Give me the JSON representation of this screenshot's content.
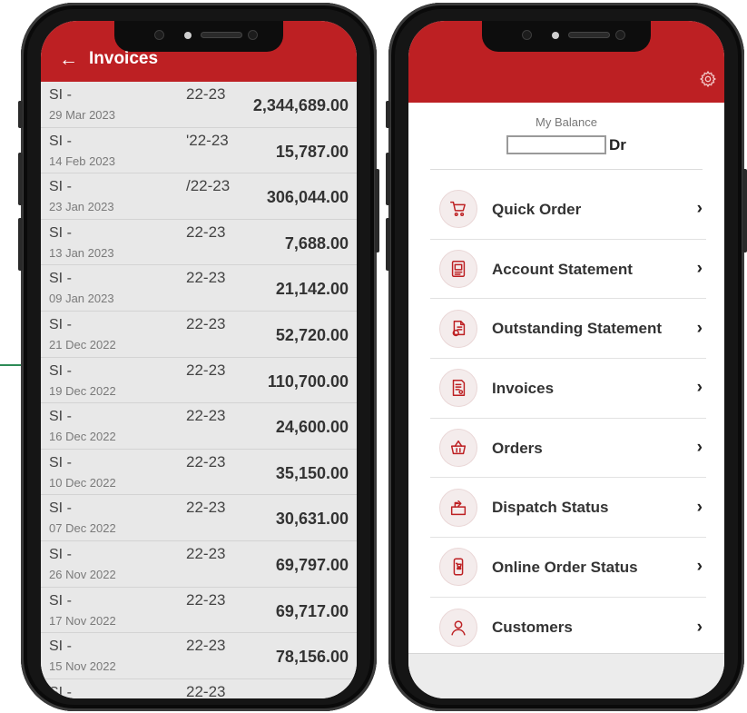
{
  "left_screen": {
    "title": "Invoices",
    "invoices": [
      {
        "code": "SI -",
        "date": "29 Mar 2023",
        "year": "22-23",
        "amount": "2,344,689.00"
      },
      {
        "code": "SI -",
        "date": "14 Feb 2023",
        "year": "'22-23",
        "amount": "15,787.00"
      },
      {
        "code": "SI -",
        "date": "23 Jan 2023",
        "year": "/22-23",
        "amount": "306,044.00"
      },
      {
        "code": "SI -",
        "date": "13 Jan 2023",
        "year": "22-23",
        "amount": "7,688.00"
      },
      {
        "code": "SI -",
        "date": "09 Jan 2023",
        "year": "22-23",
        "amount": "21,142.00"
      },
      {
        "code": "SI -",
        "date": "21 Dec 2022",
        "year": "22-23",
        "amount": "52,720.00"
      },
      {
        "code": "SI -",
        "date": "19 Dec 2022",
        "year": "22-23",
        "amount": "110,700.00"
      },
      {
        "code": "SI -",
        "date": "16 Dec 2022",
        "year": "22-23",
        "amount": "24,600.00"
      },
      {
        "code": "SI -",
        "date": "10 Dec 2022",
        "year": "22-23",
        "amount": "35,150.00"
      },
      {
        "code": "SI -",
        "date": "07 Dec 2022",
        "year": "22-23",
        "amount": "30,631.00"
      },
      {
        "code": "SI -",
        "date": "26 Nov 2022",
        "year": "22-23",
        "amount": "69,797.00"
      },
      {
        "code": "SI -",
        "date": "17 Nov 2022",
        "year": "22-23",
        "amount": "69,717.00"
      },
      {
        "code": "SI -",
        "date": "15 Nov 2022",
        "year": "22-23",
        "amount": "78,156.00"
      },
      {
        "code": "SI -",
        "date": "",
        "year": "22-23",
        "amount": ""
      }
    ]
  },
  "right_screen": {
    "balance_label": "My Balance",
    "balance_suffix": "Dr",
    "menu": [
      {
        "label": "Quick Order",
        "icon": "cart-icon"
      },
      {
        "label": "Account Statement",
        "icon": "statement-icon"
      },
      {
        "label": "Outstanding Statement",
        "icon": "outstanding-icon"
      },
      {
        "label": "Invoices",
        "icon": "invoice-icon"
      },
      {
        "label": "Orders",
        "icon": "basket-icon"
      },
      {
        "label": "Dispatch Status",
        "icon": "dispatch-icon"
      },
      {
        "label": "Online Order Status",
        "icon": "phone-order-icon"
      },
      {
        "label": "Customers",
        "icon": "user-icon"
      }
    ]
  },
  "colors": {
    "brand_red": "#bd2023",
    "list_background": "#e8e8e8"
  }
}
